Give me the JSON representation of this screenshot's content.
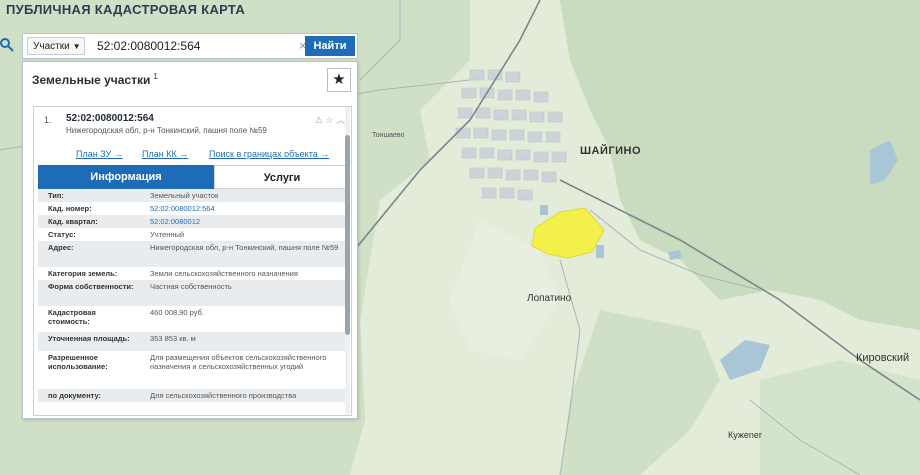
{
  "header": {
    "title": "ПУБЛИЧНАЯ КАДАСТРОВАЯ КАРТА"
  },
  "search": {
    "type_label": "Участки",
    "query": "52:02:0080012:564",
    "find_label": "Найти"
  },
  "panel": {
    "title": "Земельные участки",
    "count": "1",
    "result": {
      "index": "1.",
      "cadastral_number": "52:02:0080012:564",
      "address": "Нижегородская обл, р-н Тонкинский, пашня поле №59",
      "links": [
        "План ЗУ →",
        "План КК →",
        "Поиск в границах объекта →"
      ],
      "tabs": [
        "Информация",
        "Услуги"
      ],
      "rows": [
        {
          "k": "Тип:",
          "v": "Земельный участок",
          "link": false
        },
        {
          "k": "Кад. номер:",
          "v": "52:02:0080012:564",
          "link": true
        },
        {
          "k": "Кад. квартал:",
          "v": "52:02:0080012",
          "link": true
        },
        {
          "k": "Статус:",
          "v": "Учтенный",
          "link": false
        },
        {
          "k": "Адрес:",
          "v": "Нижегородская обл, р-н Тонкинский, пашня поле №59",
          "link": false
        },
        {
          "k": "Категория земель:",
          "v": "Земли сельскохозяйственного назначения",
          "link": false
        },
        {
          "k": "Форма собственности:",
          "v": "Частная собственность",
          "link": false
        },
        {
          "k": "Кадастровая стоимость:",
          "v": "460 008,90 руб.",
          "link": false
        },
        {
          "k": "Уточненная площадь:",
          "v": "353 853 кв. м",
          "link": false
        },
        {
          "k": "Разрешенное использование:",
          "v": "Для размещения объектов сельскохозяйственного назначения и сельскохозяйственных угодий",
          "link": false
        },
        {
          "k": "по документу:",
          "v": "Для сельскохозяйственного производства",
          "link": false
        }
      ]
    }
  },
  "map": {
    "labels": {
      "shaigino": "ШАЙГИНО",
      "lopatino": "Лопатино",
      "kirovsky": "Кировский",
      "kuzhener": "Кужener",
      "tonshaevo": "Тоншаево"
    },
    "highlight_color": "#f4f04a"
  }
}
